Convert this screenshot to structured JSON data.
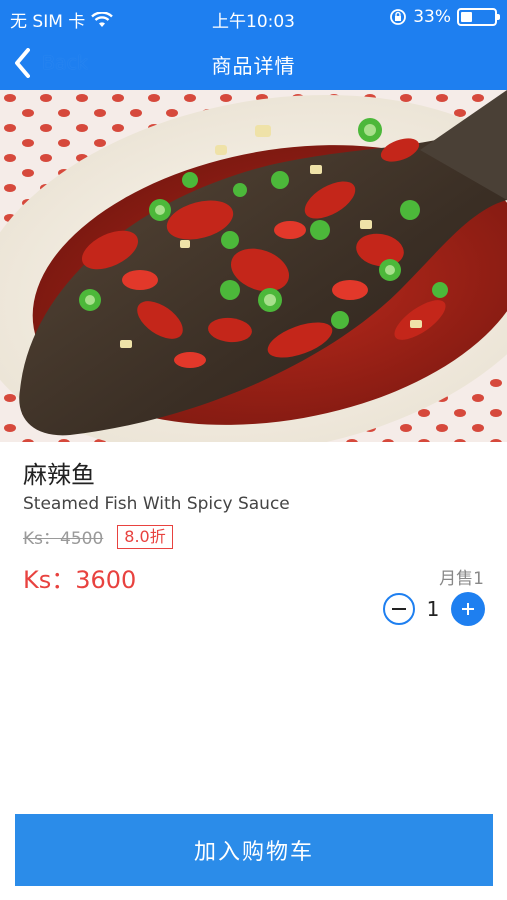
{
  "status_bar": {
    "carrier": "无 SIM 卡",
    "time": "上午10:03",
    "battery": "33%",
    "battery_level": 0.33
  },
  "nav": {
    "back_label": "Back",
    "title": "商品详情"
  },
  "product": {
    "name": "麻辣鱼",
    "english_name": "Steamed Fish With Spicy Sauce",
    "original_price": "Ks：4500",
    "discount": "8.0折",
    "price": "Ks：3600",
    "monthly_sales": "月售1",
    "quantity": "1"
  },
  "actions": {
    "add_to_cart": "加入购物车"
  },
  "colors": {
    "primary": "#1e7ff0",
    "price_red": "#e8423f",
    "button": "#2b8ce9"
  }
}
